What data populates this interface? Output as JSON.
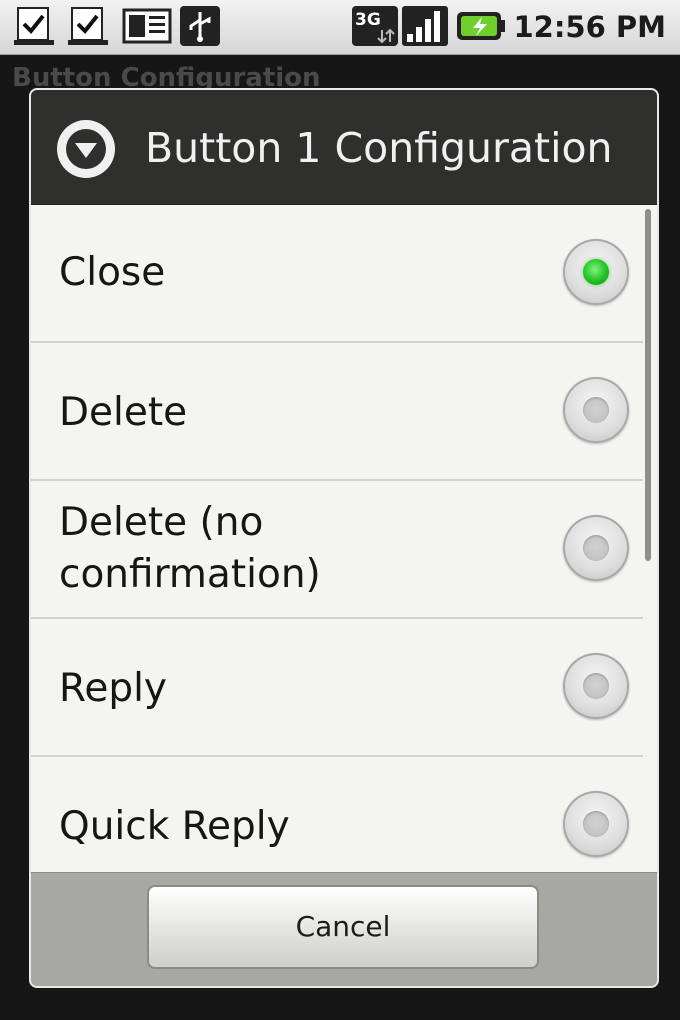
{
  "status_bar": {
    "icons": [
      "download-done-icon",
      "download-done-icon",
      "news-icon",
      "usb-icon",
      "3g-signal-icon",
      "signal-bars-icon",
      "battery-charging-icon"
    ],
    "network_type": "3G",
    "time": "12:56 PM"
  },
  "background": {
    "title": "Button Configuration"
  },
  "dialog": {
    "title": "Button 1 Configuration",
    "icon": "dropdown-circle-icon",
    "selected_index": 0,
    "options": [
      {
        "label": "Close",
        "checked": true
      },
      {
        "label": "Delete",
        "checked": false
      },
      {
        "label": "Delete (no confirmation)",
        "checked": false
      },
      {
        "label": "Reply",
        "checked": false
      },
      {
        "label": "Quick Reply",
        "checked": false
      }
    ],
    "cancel_label": "Cancel"
  },
  "colors": {
    "selected_radio": "#23c123",
    "header_bg": "#2f302e",
    "list_bg": "#f4f5f0",
    "footer_bg": "#a7a8a2"
  }
}
